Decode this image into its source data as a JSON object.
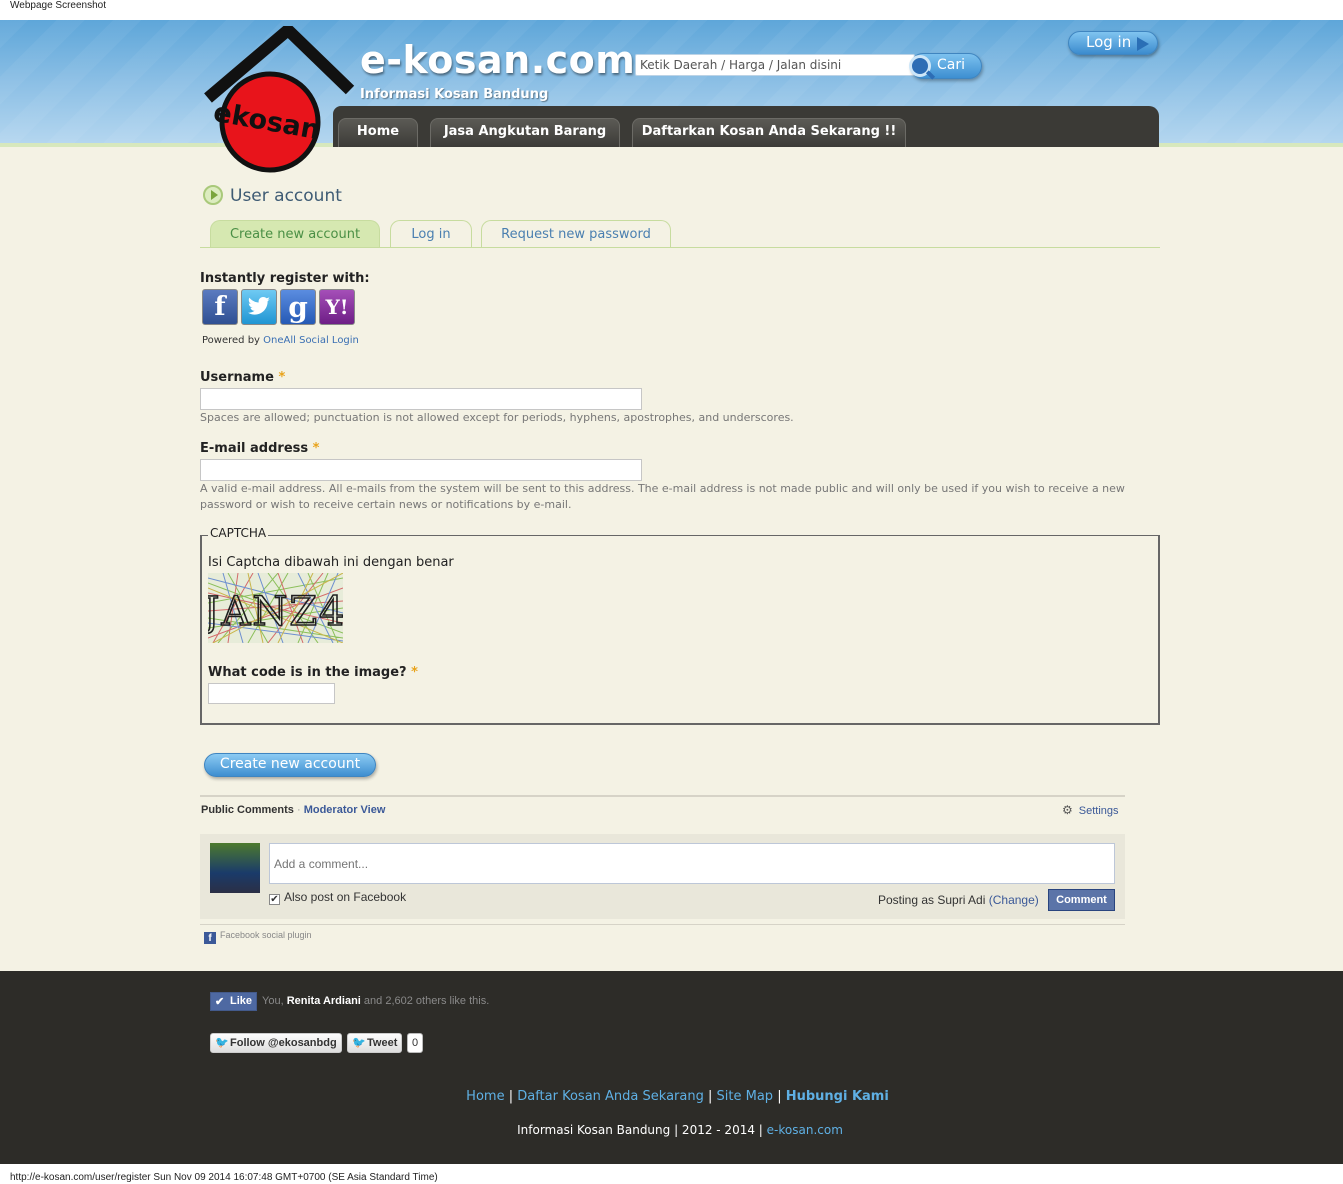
{
  "screenshot_title": "Webpage Screenshot",
  "header": {
    "logo_text": "ekosan",
    "site_name": "e-kosan.com",
    "slogan": "Informasi Kosan Bandung",
    "search_placeholder": "Ketik Daerah / Harga / Jalan disini",
    "search_button": "Cari",
    "login_button": "Log in",
    "nav": [
      "Home",
      "Jasa Angkutan Barang",
      "Daftarkan Kosan Anda Sekarang !!"
    ]
  },
  "content": {
    "page_title": "User account",
    "tabs": [
      "Create new account",
      "Log in",
      "Request new password"
    ],
    "active_tab": "Create new account",
    "instant_register": "Instantly register with:",
    "social_providers": [
      "facebook",
      "twitter",
      "google",
      "yahoo"
    ],
    "social_icon_text": {
      "facebook": "f",
      "google": "g",
      "yahoo": "Y!"
    },
    "powered_by": "Powered by",
    "powered_link": "OneAll Social Login",
    "username_label": "Username",
    "required_mark": "*",
    "username_value": "",
    "username_desc": "Spaces are allowed; punctuation is not allowed except for periods, hyphens, apostrophes, and underscores.",
    "email_label": "E-mail address",
    "email_value": "",
    "email_desc": "A valid e-mail address. All e-mails from the system will be sent to this address. The e-mail address is not made public and will only be used if you wish to receive a new password or wish to receive certain news or notifications by e-mail.",
    "captcha": {
      "legend": "CAPTCHA",
      "instruction": "Isi Captcha dibawah ini dengan benar",
      "image_code": "JANZ4",
      "question": "What code is in the image?",
      "answer_value": ""
    },
    "submit_button": "Create new account"
  },
  "comments": {
    "tab_public": "Public Comments",
    "separator": "·",
    "tab_moderator": "Moderator View",
    "settings": "Settings",
    "placeholder": "Add a comment...",
    "also_post": "Also post on Facebook",
    "posting_as": "Posting as Supri Adi",
    "change": "(Change)",
    "comment_button": "Comment",
    "plugin_label": "Facebook social plugin"
  },
  "footer": {
    "like_button": "Like",
    "like_you": "You,",
    "like_name": "Renita Ardiani",
    "like_rest": "and 2,602 others like this.",
    "follow_button": "Follow @ekosanbdg",
    "tweet_button": "Tweet",
    "tweet_count": "0",
    "links": [
      "Home",
      "Daftar Kosan Anda Sekarang",
      "Site Map",
      "Hubungi Kami"
    ],
    "link_separator": "|",
    "copyright": "Informasi Kosan Bandung | 2012 - 2014 |",
    "copyright_link": "e-kosan.com"
  },
  "status_line": "http://e-kosan.com/user/register Sun Nov 09 2014 16:07:48 GMT+0700 (SE Asia Standard Time)",
  "colors": {
    "header_blue": "#5ea6d9",
    "page_bg": "#f4f2e4",
    "nav_dark": "#3b3a36",
    "footer_bg": "#2d2c28",
    "link_blue": "#5fb0e4",
    "facebook_blue": "#3b5998",
    "required_orange": "#e8a31b",
    "tab_active_green": "#d6e8b1"
  }
}
